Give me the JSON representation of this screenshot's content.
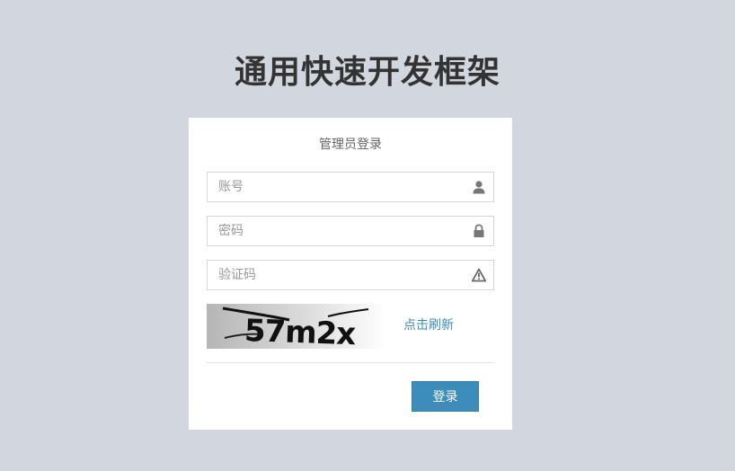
{
  "page": {
    "title": "通用快速开发框架"
  },
  "login": {
    "box_title": "管理员登录",
    "account": {
      "placeholder": "账号",
      "value": "",
      "icon": "user-icon"
    },
    "password": {
      "placeholder": "密码",
      "value": "",
      "icon": "lock-icon"
    },
    "captcha": {
      "placeholder": "验证码",
      "value": "",
      "icon": "warning-icon"
    },
    "captcha_image_text": "57m2x",
    "refresh_label": "点击刷新",
    "submit_label": "登录"
  },
  "colors": {
    "background": "#d2d6de",
    "accent": "#3c8dbc",
    "title": "#333333"
  }
}
